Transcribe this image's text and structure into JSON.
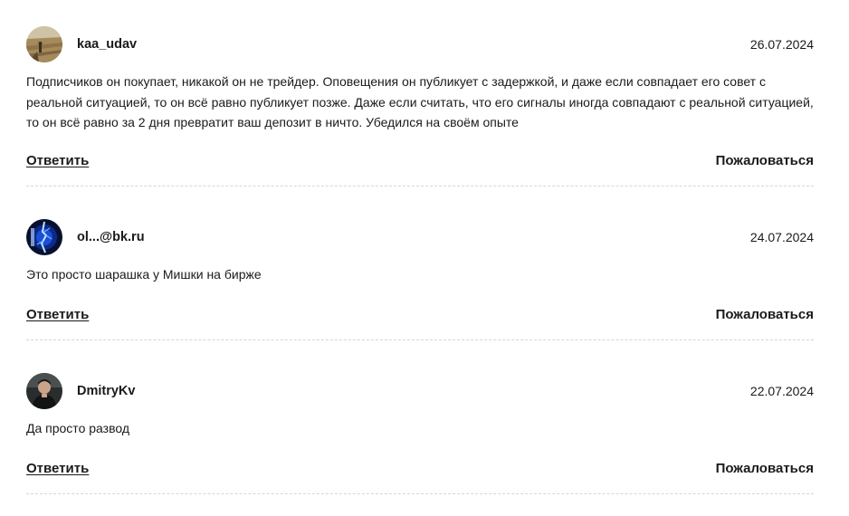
{
  "comments": [
    {
      "username": "kaa_udav",
      "date": "26.07.2024",
      "avatar_icon": "field-landscape-avatar",
      "text": "Подписчиков он покупает, никакой он не трейдер. Оповещения он публикует с задержкой, и даже если совпадает его совет с реальной ситуацией, то он всё равно публикует позже. Даже если считать, что его сигналы иногда совпадают с реальной ситуацией, то он всё равно за 2 дня превратит ваш депозит в ничто. Убедился на своём опыте",
      "reply_label": "Ответить",
      "report_label": "Пожаловаться"
    },
    {
      "username": "ol...@bk.ru",
      "date": "24.07.2024",
      "avatar_icon": "blue-lightning-avatar",
      "text": "Это просто шарашка у Мишки на бирже",
      "reply_label": "Ответить",
      "report_label": "Пожаловаться"
    },
    {
      "username": "DmitryKv",
      "date": "22.07.2024",
      "avatar_icon": "person-photo-avatar",
      "text": "Да просто развод",
      "reply_label": "Ответить",
      "report_label": "Пожаловаться"
    }
  ]
}
